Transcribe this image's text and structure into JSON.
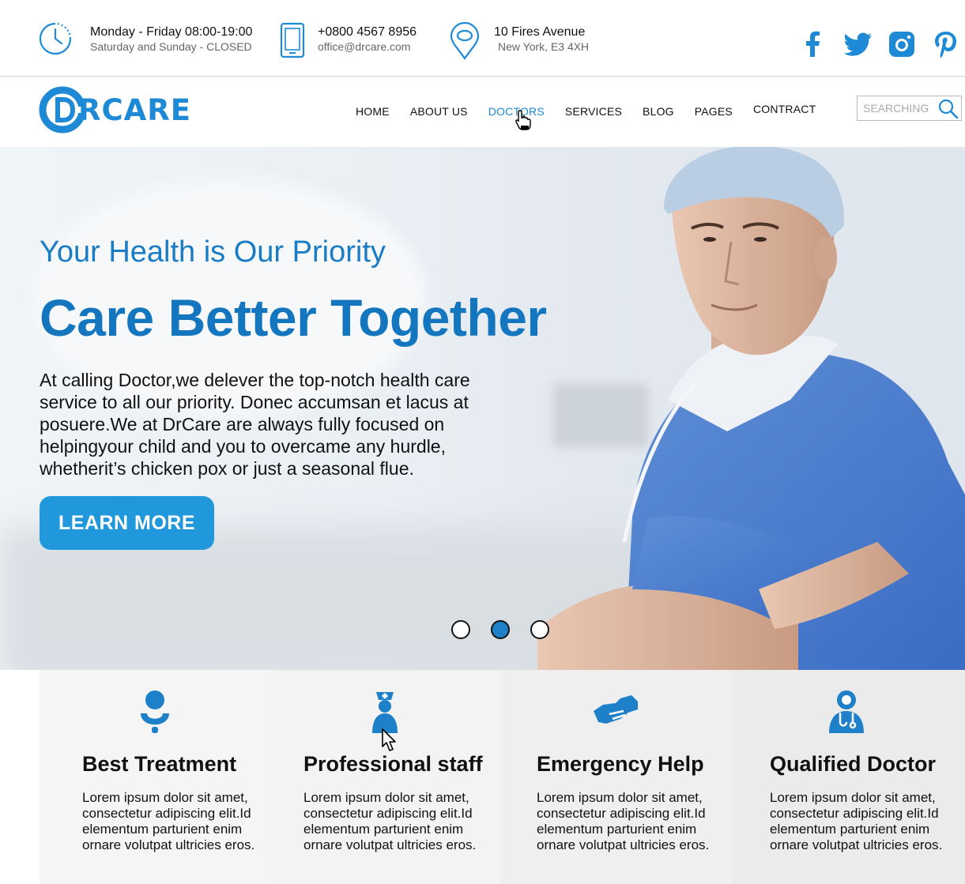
{
  "colors": {
    "brand": "#1e8ad6",
    "brand_dark": "#1576c0",
    "button": "#2098db",
    "active_dot": "#1e80c8"
  },
  "topbar": {
    "hours": {
      "line1": "Monday - Friday 08:00-19:00",
      "line2": "Saturday and Sunday - CLOSED",
      "icon": "clock-icon"
    },
    "contact": {
      "line1": "+0800 4567 8956",
      "line2": "office@drcare.com",
      "icon": "phone-icon"
    },
    "address": {
      "line1": "10 Fires Avenue",
      "line2": "New York, E3 4XH",
      "icon": "map-pin-icon"
    },
    "social": [
      "facebook-icon",
      "twitter-icon",
      "instagram-icon",
      "pinterest-icon"
    ]
  },
  "nav": {
    "logo_text": "RCARE",
    "items": [
      {
        "label": "HOME"
      },
      {
        "label": "ABOUT US"
      },
      {
        "label": "DOCTORS",
        "active": true
      },
      {
        "label": "SERVICES"
      },
      {
        "label": "BLOG"
      },
      {
        "label": "PAGES"
      },
      {
        "label": "CONTRACT"
      }
    ],
    "search_placeholder": "SEARCHING"
  },
  "hero": {
    "subtitle": "Your Health is Our Priority",
    "title": "Care Better Together",
    "body": "At calling Doctor,we delever the top-notch health care service to all our priority. Donec accumsan et lacus at posuere.We at DrCare are always fully focused on helpingyour child and you to overcame any hurdle, whetherit’s chicken pox or just a seasonal flue.",
    "button": "LEARN MORE",
    "slides": 3,
    "active_slide": 2
  },
  "features": [
    {
      "title": "Best Treatment",
      "icon": "treatment-icon",
      "body": "Lorem ipsum dolor sit amet, consectetur adipiscing elit.Id elementum parturient enim ornare volutpat ultricies eros."
    },
    {
      "title": "Professional staff",
      "icon": "nurse-icon",
      "body": "Lorem ipsum dolor sit amet, consectetur adipiscing elit.Id elementum parturient enim ornare volutpat ultricies eros."
    },
    {
      "title": "Emergency Help",
      "icon": "handshake-icon",
      "body": "Lorem ipsum dolor sit amet, consectetur adipiscing elit.Id elementum parturient enim ornare volutpat ultricies eros."
    },
    {
      "title": "Qualified Doctor",
      "icon": "doctor-icon",
      "body": "Lorem ipsum dolor sit amet, consectetur adipiscing elit.Id elementum parturient enim ornare volutpat ultricies eros."
    }
  ]
}
